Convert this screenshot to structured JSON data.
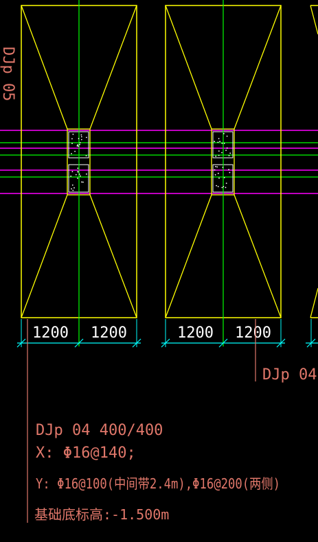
{
  "drawing": {
    "left_edge_label": "DJp 05",
    "dimensions": [
      "1200",
      "1200",
      "1200",
      "1200"
    ],
    "callout_label": "DJp 04",
    "annotation": {
      "line1": "DJp 04 400/400",
      "line2": "X: Φ16@140;",
      "line3": "Y: Φ16@100(中间带2.4m),Φ16@200(两侧)",
      "line4": "基础底标高:-1.500m"
    }
  },
  "colors": {
    "background": "#000000",
    "outline": "#ffff00",
    "axis": "#00ff00",
    "beam": "#ff00ff",
    "dimension": "#00ffff",
    "annotation": "#e0776a",
    "column_dots": "#ffffff"
  }
}
